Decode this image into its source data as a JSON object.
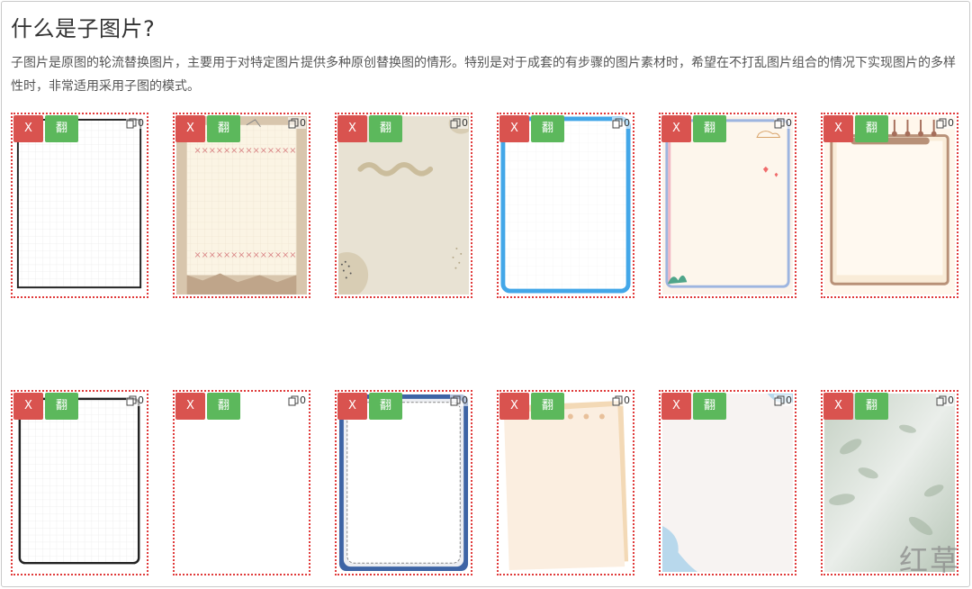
{
  "page": {
    "title": "什么是子图片?",
    "description": "子图片是原图的轮流替换图片，主要用于对特定图片提供多种原创替换图的情形。特别是对于成套的有步骤的图片素材时，希望在不打乱图片组合的情况下实现图片的多样性时，非常适用采用子图的模式。"
  },
  "buttons": {
    "delete_label": "X",
    "flip_label": "翻"
  },
  "cards": [
    {
      "style": "grid-black",
      "sub_count": "0"
    },
    {
      "style": "kraft-note",
      "sub_count": "0"
    },
    {
      "style": "beige-dots",
      "sub_count": "0"
    },
    {
      "style": "blue-frame",
      "sub_count": "0"
    },
    {
      "style": "pink-frame",
      "sub_count": "0"
    },
    {
      "style": "ring-notebook",
      "sub_count": "0"
    },
    {
      "style": "grid-rounded",
      "sub_count": "0"
    },
    {
      "style": "blank",
      "sub_count": "0"
    },
    {
      "style": "navy-dashed",
      "sub_count": "0"
    },
    {
      "style": "peach-notes",
      "sub_count": "0"
    },
    {
      "style": "blue-corners",
      "sub_count": "0"
    },
    {
      "style": "green-shadow",
      "sub_count": "0"
    }
  ],
  "watermark": "红草",
  "colors": {
    "delete": "#d9534f",
    "flip": "#5cb85c",
    "card_border": "#e03a3a"
  }
}
